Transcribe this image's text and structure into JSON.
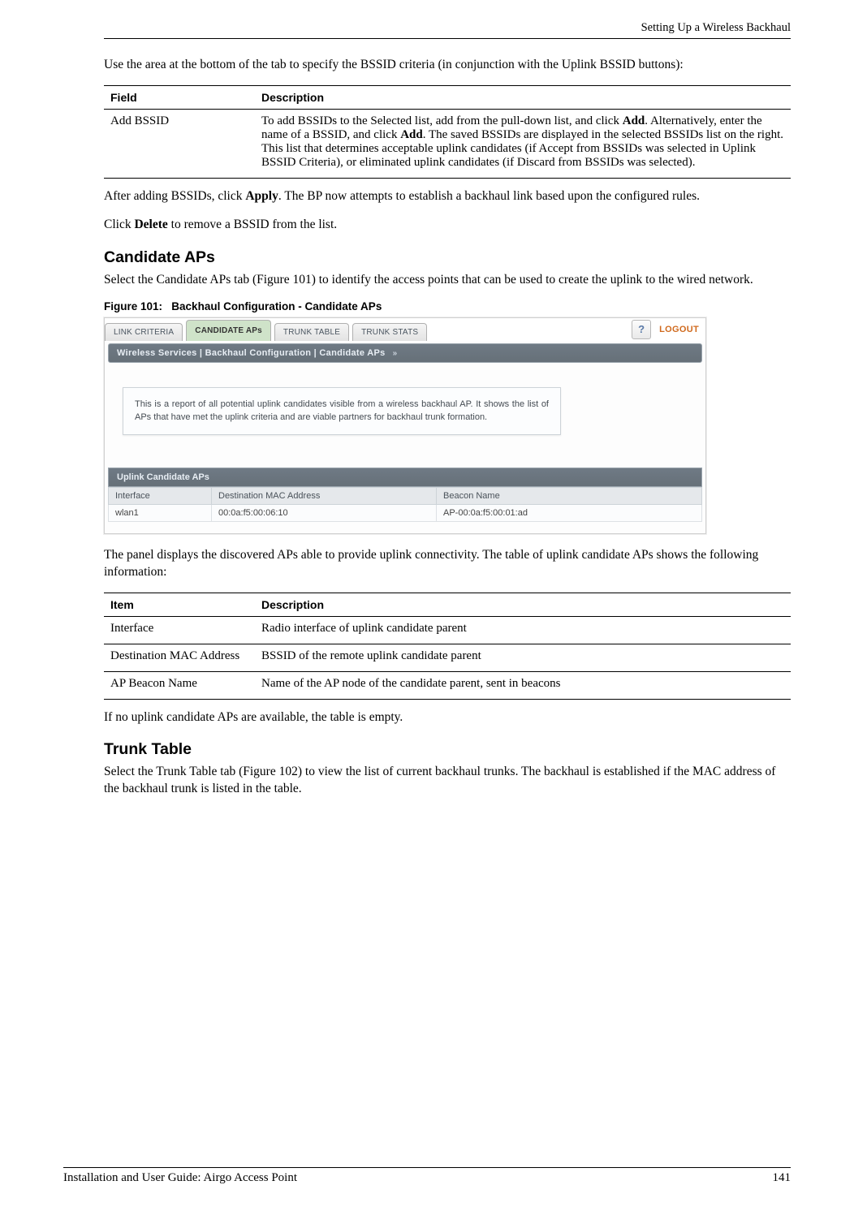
{
  "running_head": "Setting Up a Wireless Backhaul",
  "intro": "Use the area at the bottom of the tab to specify the BSSID criteria (in conjunction with the Uplink BSSID buttons):",
  "table1": {
    "header_field": "Field",
    "header_desc": "Description",
    "field": "Add BSSID",
    "desc_part1": "To add BSSIDs to the Selected list, add from the pull-down list, and click ",
    "desc_bold1": "Add",
    "desc_part2": ". Alternatively, enter the name of a BSSID, and click ",
    "desc_bold2": "Add",
    "desc_part3": ". The saved BSSIDs are displayed in the selected BSSIDs list on the right. This list that determines acceptable uplink candidates (if Accept from BSSIDs was selected in Uplink BSSID Criteria), or eliminated uplink candidates (if Discard from BSSIDs was selected)."
  },
  "para_after1_a": "After adding BSSIDs, click ",
  "para_after1_bold": "Apply",
  "para_after1_b": ". The BP now attempts to establish a backhaul link based upon the configured rules.",
  "para_after2_a": "Click ",
  "para_after2_bold": "Delete",
  "para_after2_b": " to remove a BSSID from the list.",
  "heading_candidate": "Candidate APs",
  "candidate_intro": "Select the Candidate APs tab (Figure 101) to identify the access points that can be used to create the uplink to the wired network.",
  "fig_label_num": "Figure 101:",
  "fig_label_text": "Backhaul Configuration - Candidate APs",
  "ui": {
    "tabs": {
      "link_criteria": "LINK CRITERIA",
      "candidate_aps": "CANDIDATE APs",
      "trunk_table": "TRUNK TABLE",
      "trunk_stats": "TRUNK STATS"
    },
    "help": "?",
    "logout": "LOGOUT",
    "breadcrumb": "Wireless Services | Backhaul Configuration | Candidate APs",
    "breadcrumb_sep": "»",
    "description": "This is a report of all potential uplink candidates visible from a wireless backhaul AP. It shows the list of APs that have met the uplink criteria and are viable partners for backhaul trunk formation.",
    "section_title": "Uplink Candidate APs",
    "table": {
      "h1": "Interface",
      "h2": "Destination MAC Address",
      "h3": "Beacon Name",
      "r1c1": "wlan1",
      "r1c2": "00:0a:f5:00:06:10",
      "r1c3": "AP-00:0a:f5:00:01:ad"
    }
  },
  "candidate_after": "The panel displays the discovered APs able to provide uplink connectivity. The table of uplink candidate APs shows the following information:",
  "table2": {
    "header_item": "Item",
    "header_desc": "Description",
    "rows": [
      {
        "item": "Interface",
        "desc": "Radio interface of uplink candidate parent"
      },
      {
        "item": "Destination MAC Address",
        "desc": "BSSID of the remote uplink candidate parent"
      },
      {
        "item": "AP Beacon Name",
        "desc": "Name of the AP node of the candidate parent, sent in beacons"
      }
    ]
  },
  "no_uplink": "If no uplink candidate APs are available, the table is empty.",
  "heading_trunk": "Trunk Table",
  "trunk_intro": "Select the Trunk Table tab (Figure 102) to view the list of current backhaul trunks. The backhaul is established if the MAC address of the backhaul trunk is listed in the table.",
  "footer_left": "Installation and User Guide: Airgo Access Point",
  "footer_right": "141"
}
